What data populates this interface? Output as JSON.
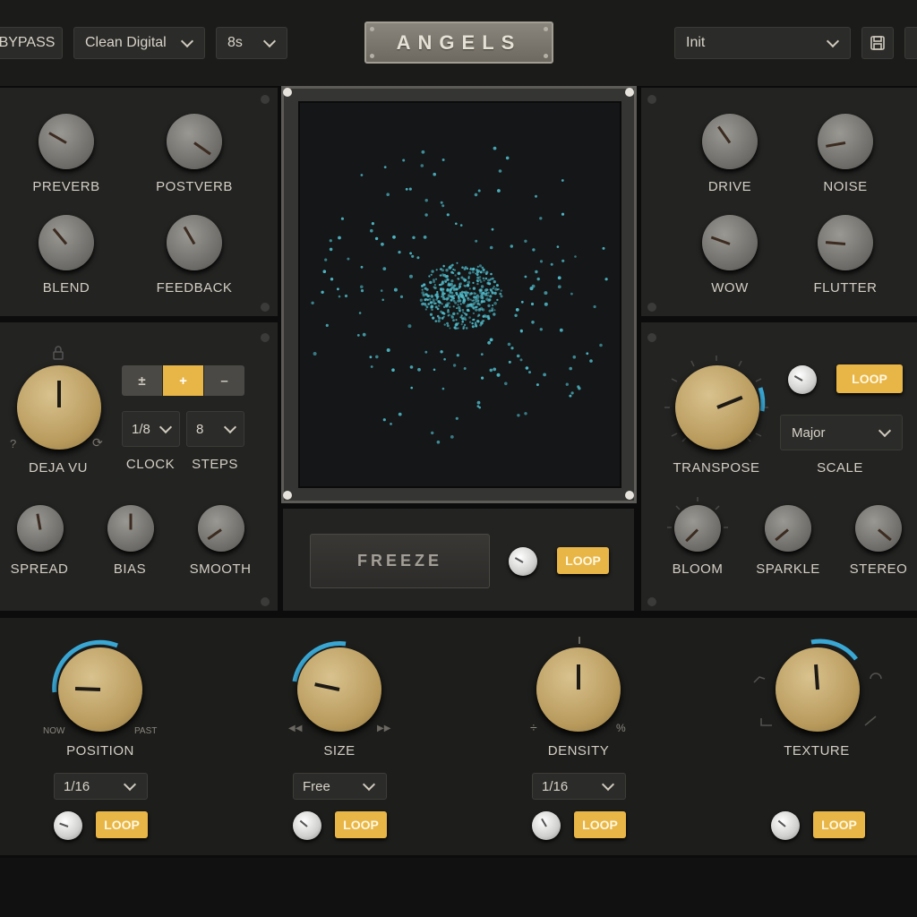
{
  "header": {
    "bypass_label": "BYPASS",
    "algorithm": "Clean Digital",
    "buffer": "8s",
    "title": "ANGELS",
    "preset": "Init",
    "save_icon": "floppy-disk-icon",
    "accent": "#e8b547"
  },
  "left_top": {
    "knobs": [
      {
        "label": "PREVERB"
      },
      {
        "label": "POSTVERB"
      },
      {
        "label": "BLEND"
      },
      {
        "label": "FEEDBACK"
      }
    ]
  },
  "deja_vu": {
    "label": "DEJA VU",
    "help": "?",
    "reset": "⟳",
    "mode_buttons": [
      "±",
      "+",
      "–"
    ],
    "mode_selected": "+",
    "clock_value": "1/8",
    "clock_label": "CLOCK",
    "steps_value": "8",
    "steps_label": "STEPS",
    "small_knobs": [
      {
        "label": "SPREAD"
      },
      {
        "label": "BIAS"
      },
      {
        "label": "SMOOTH"
      }
    ]
  },
  "right_top": {
    "knobs": [
      {
        "label": "DRIVE"
      },
      {
        "label": "NOISE"
      },
      {
        "label": "WOW"
      },
      {
        "label": "FLUTTER"
      }
    ]
  },
  "transpose": {
    "label": "TRANSPOSE",
    "loop_label": "LOOP",
    "scale_value": "Major",
    "scale_label": "SCALE",
    "small_knobs": [
      {
        "label": "BLOOM"
      },
      {
        "label": "SPARKLE"
      },
      {
        "label": "STEREO"
      }
    ]
  },
  "center": {
    "freeze_label": "FREEZE",
    "loop_label": "LOOP",
    "particle_color": "#4fb7c6"
  },
  "bottom": {
    "position": {
      "label": "POSITION",
      "left": "NOW",
      "right": "PAST",
      "select": "1/16",
      "loop": "LOOP"
    },
    "size": {
      "label": "SIZE",
      "left": "◀◀",
      "right": "▶▶",
      "select": "Free",
      "loop": "LOOP"
    },
    "density": {
      "label": "DENSITY",
      "left": "÷",
      "right": "%",
      "select": "1/16",
      "loop": "LOOP"
    },
    "texture": {
      "label": "TEXTURE",
      "loop": "LOOP"
    }
  }
}
